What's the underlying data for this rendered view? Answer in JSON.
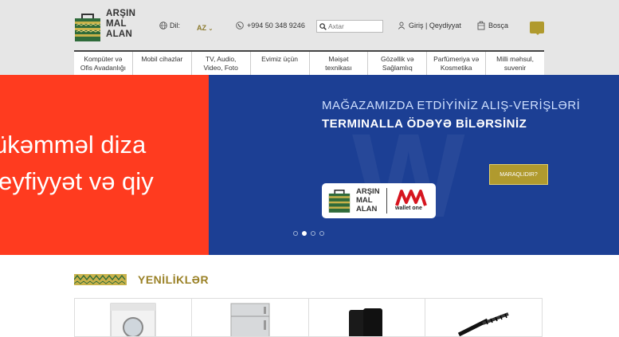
{
  "header": {
    "logo_lines": [
      "ARŞIN",
      "MAL",
      "ALAN"
    ],
    "lang_label": "Dil:",
    "lang_value": "AZ",
    "phone": "+994 50 348 9246",
    "search_placeholder": "Axtar",
    "login_label": "Giriş | Qeydiyyat",
    "cart_label": "Bosça"
  },
  "nav": {
    "items": [
      [
        "Kompüter və",
        "Ofis Avadanlığı"
      ],
      [
        "Mobil cihazlar",
        ""
      ],
      [
        "TV, Audio,",
        "Video, Foto"
      ],
      [
        "Evimiz üçün",
        ""
      ],
      [
        "Məişət",
        "texnikası"
      ],
      [
        "Gözəllik və",
        "Sağlamlıq"
      ],
      [
        "Parfümeriya və",
        "Kosmetika"
      ],
      [
        "Milli məhsul,",
        "suvenir"
      ]
    ]
  },
  "banner": {
    "left_line1": "ükəmməl diza",
    "left_line2": "eyfiyyət və qiy",
    "right_line1": "MAĞAZAMIZDA ETDİYİNİZ ALIŞ-VERİŞLƏRİ",
    "right_line2": "TERMINALLA ÖDƏYƏ BİLƏRSİNİZ",
    "button_label": "MARAQLIDIR?",
    "card_logo_lines": [
      "ARŞIN",
      "MAL",
      "ALAN"
    ],
    "card_partner": "wallet one",
    "active_slide": 2,
    "slide_count": 4
  },
  "section": {
    "title": "YENİLİKLƏR"
  },
  "colors": {
    "accent_gold": "#b09a2e",
    "banner_red": "#ff3b1f",
    "banner_blue": "#1c3f94"
  }
}
